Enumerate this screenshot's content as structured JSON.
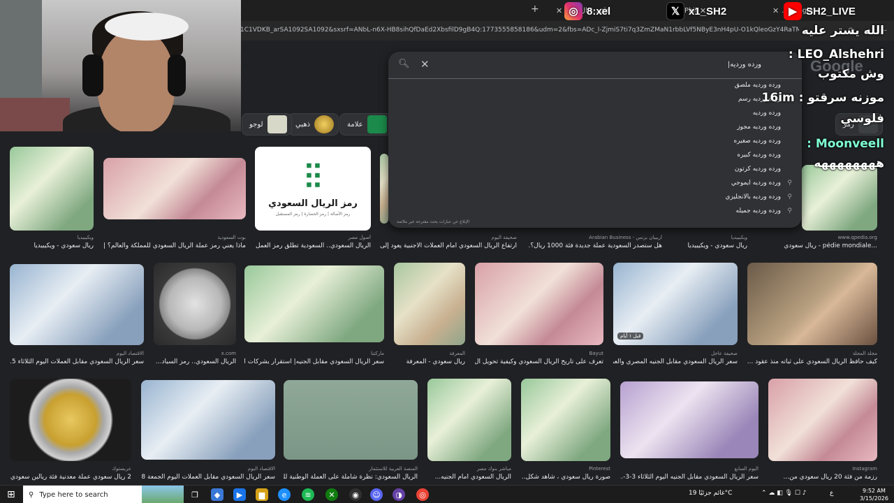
{
  "browser": {
    "tabs": [
      {
        "label": "ريال سعو...gle",
        "close": "✕"
      },
      {
        "label": "الهلا...Phil",
        "close": "✕"
      },
      {
        "label": "...Google",
        "close": "✕"
      }
    ],
    "new_tab": "+",
    "url": "1C1VDKB_arSA1092SA1092&sxsrf=ANbL-n6X-HB8sihQfDaEd2XbsfilD9gB4Q:1773555858186&udm=2&fbs=ADc_l-ZjmiS7ti7q3ZmZMaN1rbbLVf5NByE3nH4pU-O1kQleoGzY4RaTMbxCxF"
  },
  "google": {
    "logo": "Google",
    "chips": [
      {
        "label": "علامة",
        "color": "#1b8a4a"
      },
      {
        "label": "ذهبي",
        "color": "#c8a030"
      },
      {
        "label": "لوجو",
        "color": "#d8d8c8"
      },
      {
        "label": "رمز",
        "color": "#3c4043"
      }
    ]
  },
  "search": {
    "query": "ورده ورديه|",
    "suggestions": [
      "ورده ورديه ملصق",
      "ورده ورديه رسم",
      "ورده ورديه",
      "ورده ورديه مجوز",
      "ورده ورديه صغيره",
      "ورده ورديه كبيره",
      "ورده ورديه كرتون",
      "ورده ورديه ايموجي",
      "ورده ورديه بالانجليزي",
      "ورده ورديه جميله"
    ],
    "report": "الإبلاغ عن عبارات بحث مقترحة غير ملائمة"
  },
  "results": {
    "row1": [
      {
        "title": "ريال سعودي - ويكيبيديا",
        "source": "ويكيبيديا"
      },
      {
        "title": "ماذا يعني رمز عملة الريال السعودي للمملكة والعالم؟ | ...",
        "source": "بوت السعودية"
      },
      {
        "title": "الريال السعودي.. السعودية تطلق رمز العمل...",
        "source": "أصول مصر"
      },
      {
        "title": "ارتفاع الريال السعودي أمام العملات الأجنبية يعود إلى...",
        "source": "صحيفة اليوم"
      },
      {
        "title": "هل ستصدر السعودية عملة جديدة فئة 1000 ريال؟...",
        "source": "أريبيان بزنس - Arabian Business"
      },
      {
        "title": "ريال سعودي - ويكيبيديا",
        "source": "ويكيبيديا"
      },
      {
        "title": "...pédie mondiale - ريال سعودي",
        "source": "www.qpedia.org"
      }
    ],
    "row2": [
      {
        "title": "سعر الريال السعودي مقابل العملات اليوم الثلاثاء 5...",
        "source": "الاقتصاد اليوم"
      },
      {
        "title": "الريال السعودي.. رمز السياد...",
        "source": "x.com"
      },
      {
        "title": "سعر الريال السعودي مقابل الجنيه| استقرار بشركات ال...",
        "source": "ماركتنا"
      },
      {
        "title": "ريال سعودي - المعرفة",
        "source": "المعرفة"
      },
      {
        "title": "تعرف على تاريخ الريال السعودي وكيفية تحويل ال...",
        "source": "Bayut"
      },
      {
        "title": "سعر الريال السعودي مقابل الجنيه المصري والعم...",
        "source": "صحيفة عاجل"
      },
      {
        "title": "كيف حافظ الريال السعودي على ثباته منذ عقود ...",
        "source": "مجلة المجلة"
      }
    ],
    "row3": [
      {
        "title": "2 ريال سعودي عملة معدنية فئة ريالين سعودي...",
        "source": "عربستوك"
      },
      {
        "title": "سعر الريال السعودي مقابل العملات اليوم الجمعة 8...",
        "source": "الاقتصاد اليوم"
      },
      {
        "title": "الريال السعودي: نظرة شاملة على العملة الوطنية للم...",
        "source": "المنصة العربية للاستثمار"
      },
      {
        "title": "الريال السعودي أمام الجنيه...",
        "source": "مباشر بنوك مصر"
      },
      {
        "title": "صورة ريال سعودي ، شاهد شكل...",
        "source": "Pinterest"
      },
      {
        "title": "سعر الريال السعودي مقابل الجنيه اليوم الثلاثاء 3-3-...",
        "source": "اليوم السابع"
      },
      {
        "title": "رزمة من فئة 20 ريال سعودي من...",
        "source": "Instagram"
      }
    ],
    "thumbs": {
      "logo_mark": "⫶⫶",
      "logo_title": "رمز الريال السعودي",
      "logo_sub": "رمز الأصالة | رمز الحضارة | رمز المستقبل"
    },
    "badge_ago": "قبل ١ أيام"
  },
  "overlay": {
    "instagram": "8:xel",
    "x": "x1_SH2",
    "youtube": "SH2_LIVE",
    "chat": [
      {
        "text": "الله يستر عليه"
      },
      {
        "text": "LEO_Alshehri :"
      },
      {
        "text": "وش مكتوب"
      },
      {
        "text": "موزنه سرقتو : 16im"
      },
      {
        "text": "فلوسي"
      },
      {
        "text": "Moonveell :"
      },
      {
        "text": "ههههههههه"
      }
    ]
  },
  "taskbar": {
    "search_placeholder": "Type here to search",
    "weather": "غائم جزئيًا 19°C",
    "time": "9:52 AM",
    "date": "3/15/2026",
    "lang": "ع"
  }
}
